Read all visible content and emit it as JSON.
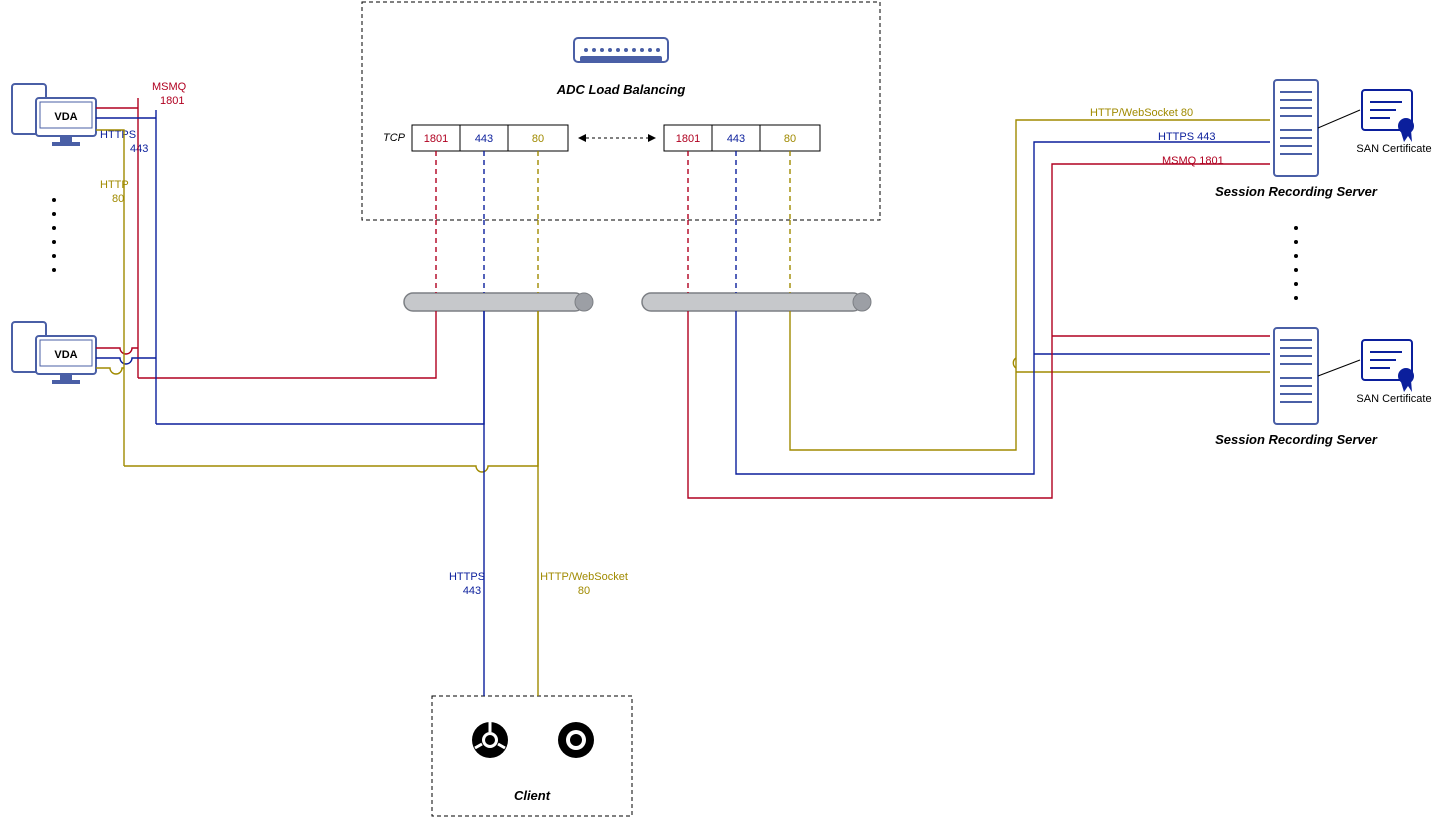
{
  "adc": {
    "title": "ADC Load Balancing",
    "tcp_label": "TCP",
    "ports": [
      "1801",
      "443",
      "80"
    ]
  },
  "vda": {
    "label": "VDA"
  },
  "left_labels": {
    "msmq": {
      "line1": "MSMQ",
      "line2": "1801"
    },
    "https": {
      "line1": "HTTPS",
      "line2": "443"
    },
    "http": {
      "line1": "HTTP",
      "line2": "80"
    }
  },
  "right_labels": {
    "http": {
      "text": "HTTP/WebSocket",
      "port": "80"
    },
    "https": {
      "text": "HTTPS",
      "port": "443"
    },
    "msmq": {
      "text": "MSMQ",
      "port": "1801"
    }
  },
  "client": {
    "title": "Client",
    "https": {
      "line1": "HTTPS",
      "line2": "443"
    },
    "http": {
      "line1": "HTTP/WebSocket",
      "line2": "80"
    }
  },
  "server": {
    "label": "Session Recording Server"
  },
  "cert": {
    "label": "SAN Certificate"
  }
}
